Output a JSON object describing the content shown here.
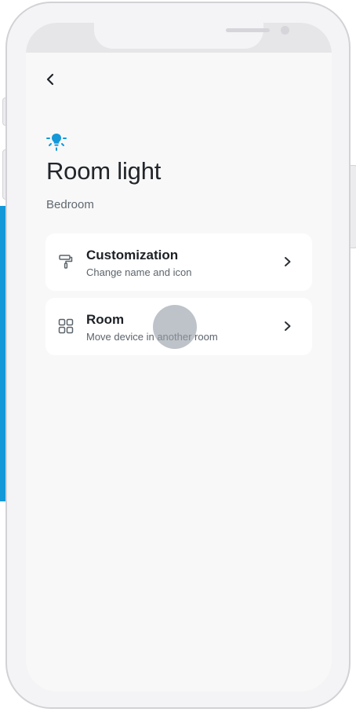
{
  "device": {
    "title": "Room light",
    "room": "Bedroom",
    "icon": "bulb-icon",
    "accent_color": "#1598d8"
  },
  "nav": {
    "back_icon": "chevron-left-icon"
  },
  "options": [
    {
      "title": "Customization",
      "description": "Change name and icon",
      "icon": "paint-roller-icon"
    },
    {
      "title": "Room",
      "description": "Move device in another room",
      "icon": "grid-icon"
    }
  ]
}
